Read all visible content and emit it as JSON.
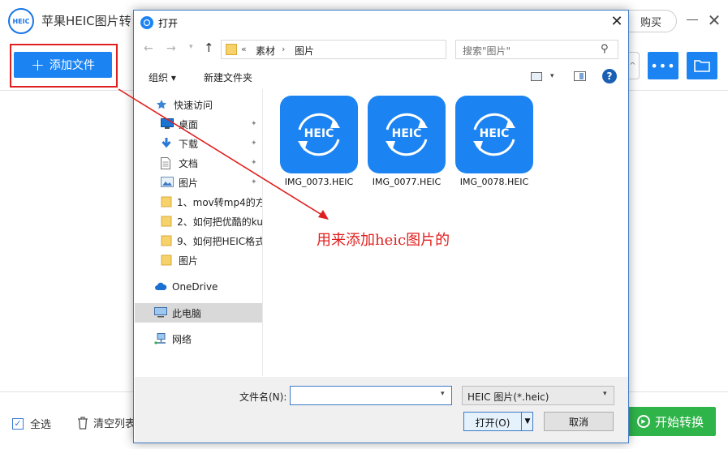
{
  "app": {
    "logo_text": "HEIC",
    "title": "苹果HEIC图片转",
    "buy_label": "购买",
    "add_file_label": "添加文件",
    "select_all_label": "全选",
    "clear_list_label": "清空列表",
    "start_convert_label": "开始转换"
  },
  "dialog": {
    "title": "打开",
    "address": {
      "prefix": "«",
      "segments": [
        "素材",
        "图片"
      ],
      "separator": "›"
    },
    "search_placeholder": "搜索\"图片\"",
    "organize_label": "组织 ▾",
    "new_folder_label": "新建文件夹",
    "nav_items": [
      {
        "label": "快速访问",
        "icon": "star-icon"
      },
      {
        "label": "桌面",
        "icon": "desktop-icon",
        "pinned": true
      },
      {
        "label": "下载",
        "icon": "download-icon",
        "pinned": true
      },
      {
        "label": "文档",
        "icon": "document-icon",
        "pinned": true
      },
      {
        "label": "图片",
        "icon": "picture-icon",
        "pinned": true
      },
      {
        "label": "1、mov转mp4的方",
        "icon": "folder-icon"
      },
      {
        "label": "2、如何把优酷的ku",
        "icon": "folder-icon"
      },
      {
        "label": "9、如何把HEIC格式",
        "icon": "folder-icon"
      },
      {
        "label": "图片",
        "icon": "folder-icon"
      },
      {
        "label": "OneDrive",
        "icon": "cloud-icon"
      },
      {
        "label": "此电脑",
        "icon": "computer-icon"
      },
      {
        "label": "网络",
        "icon": "network-icon"
      }
    ],
    "files": [
      {
        "name": "IMG_0073.HEIC",
        "badge": "HEIC"
      },
      {
        "name": "IMG_0077.HEIC",
        "badge": "HEIC"
      },
      {
        "name": "IMG_0078.HEIC",
        "badge": "HEIC"
      }
    ],
    "filename_label": "文件名(N):",
    "filename_value": "",
    "filetype_value": "HEIC 图片(*.heic)",
    "open_label": "打开(O)",
    "cancel_label": "取消"
  },
  "annotation": {
    "text": "用来添加heic图片的",
    "color": "#e0201f"
  },
  "colors": {
    "accent_blue": "#1c84f2",
    "start_green": "#2fb44a"
  }
}
